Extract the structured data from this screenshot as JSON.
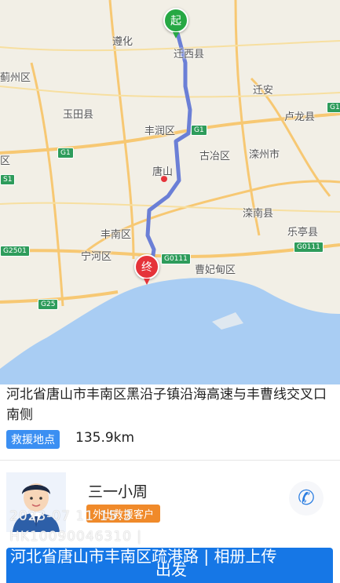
{
  "map": {
    "places": [
      {
        "id": "qianxi",
        "name": "迁西县"
      },
      {
        "id": "zunhua",
        "name": "遵化"
      },
      {
        "id": "jizhou",
        "name": "蓟州区"
      },
      {
        "id": "qianan",
        "name": "迁安"
      },
      {
        "id": "yutian",
        "name": "玉田县"
      },
      {
        "id": "fengrun",
        "name": "丰润区"
      },
      {
        "id": "lulong",
        "name": "卢龙县"
      },
      {
        "id": "guye",
        "name": "古冶区"
      },
      {
        "id": "luanzhou",
        "name": "滦州市"
      },
      {
        "id": "tangshan",
        "name": "唐山"
      },
      {
        "id": "luannan",
        "name": "滦南县"
      },
      {
        "id": "laoting",
        "name": "乐亭县"
      },
      {
        "id": "fengnan",
        "name": "丰南区"
      },
      {
        "id": "ninghe",
        "name": "宁河区"
      },
      {
        "id": "caofeidian",
        "name": "曹妃甸区"
      },
      {
        "id": "edge_qu",
        "name": "区"
      }
    ],
    "shields": [
      "G1",
      "G1",
      "G1",
      "G2501",
      "G0111",
      "G0111",
      "G25",
      "S1"
    ],
    "start_marker": "起",
    "end_marker": "终"
  },
  "details": {
    "address": "河北省唐山市丰南区黑沿子镇沿海高速与丰曹线交叉口南侧",
    "location_tag": "救援地点",
    "distance": "135.9km"
  },
  "driver": {
    "name": "三一小周",
    "badge": "外出救援客户",
    "overlay_line1": "2023-07 11 15:3",
    "overlay_line2": "HK10090046310 |"
  },
  "action": {
    "location_text": "河北省唐山市丰南区疏港路  |  相册上传",
    "label": "出发"
  },
  "colors": {
    "route": "#6b7fd6",
    "sea": "#a9cdf3",
    "button": "#1677e6",
    "tag": "#3b8ff2",
    "badge": "#f08a2a"
  }
}
